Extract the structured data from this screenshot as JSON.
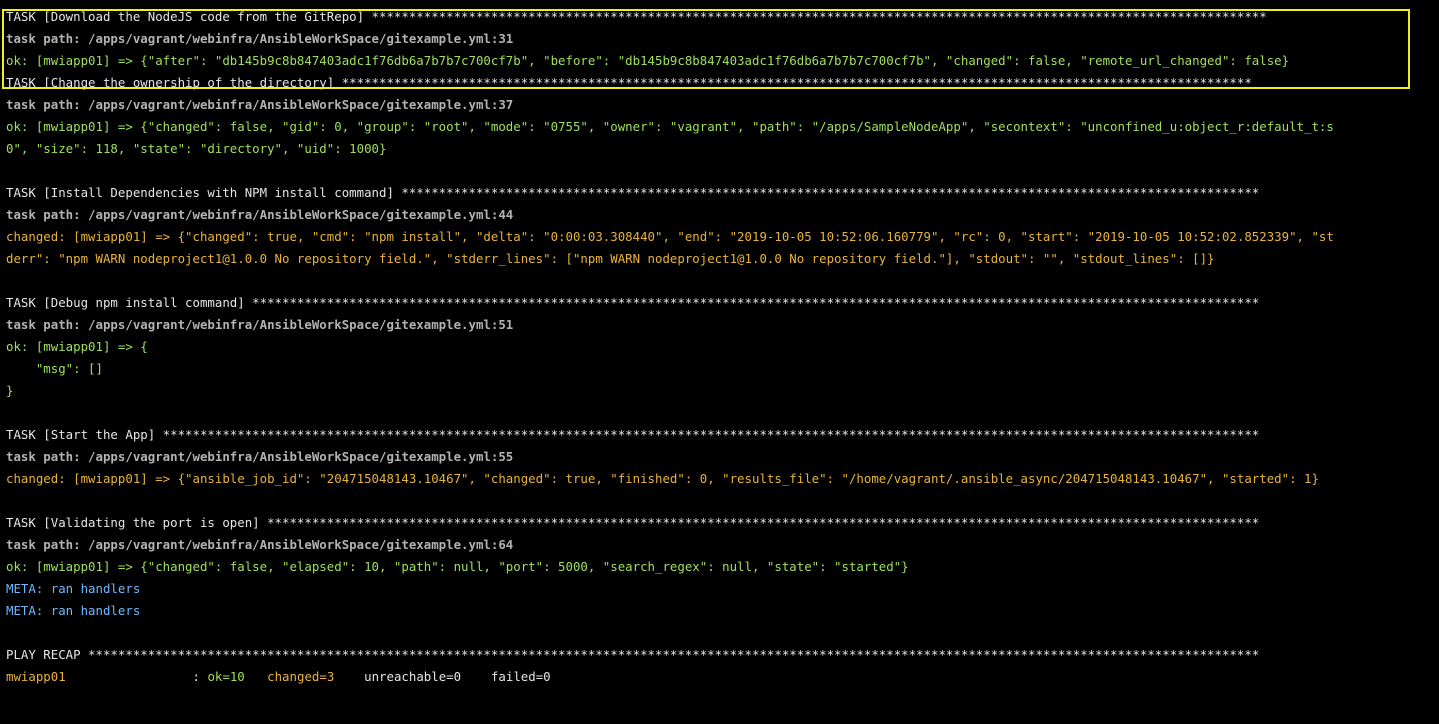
{
  "lines": [
    {
      "text": "TASK [Download the NodeJS code from the GitRepo] ************************************************************************************************************************",
      "kind": "task-header"
    },
    {
      "text": "task path: /apps/vagrant/webinfra/AnsibleWorkSpace/gitexample.yml:31",
      "kind": "task-path"
    },
    {
      "text": "ok: [mwiapp01] => {\"after\": \"db145b9c8b847403adc1f76db6a7b7b7c700cf7b\", \"before\": \"db145b9c8b847403adc1f76db6a7b7b7c700cf7b\", \"changed\": false, \"remote_url_changed\": false}",
      "kind": "ok"
    },
    {
      "text": "TASK [Change the ownership of the directory] **************************************************************************************************************************",
      "kind": "task-header"
    },
    {
      "text": "task path: /apps/vagrant/webinfra/AnsibleWorkSpace/gitexample.yml:37",
      "kind": "task-path"
    },
    {
      "text": "ok: [mwiapp01] => {\"changed\": false, \"gid\": 0, \"group\": \"root\", \"mode\": \"0755\", \"owner\": \"vagrant\", \"path\": \"/apps/SampleNodeApp\", \"secontext\": \"unconfined_u:object_r:default_t:s",
      "kind": "ok"
    },
    {
      "text": "0\", \"size\": 118, \"state\": \"directory\", \"uid\": 1000}",
      "kind": "ok"
    },
    {
      "text": "",
      "kind": "blank"
    },
    {
      "text": "TASK [Install Dependencies with NPM install command] *******************************************************************************************************************",
      "kind": "task-header"
    },
    {
      "text": "task path: /apps/vagrant/webinfra/AnsibleWorkSpace/gitexample.yml:44",
      "kind": "task-path"
    },
    {
      "text": "changed: [mwiapp01] => {\"changed\": true, \"cmd\": \"npm install\", \"delta\": \"0:00:03.308440\", \"end\": \"2019-10-05 10:52:06.160779\", \"rc\": 0, \"start\": \"2019-10-05 10:52:02.852339\", \"st",
      "kind": "changed"
    },
    {
      "text": "derr\": \"npm WARN nodeproject1@1.0.0 No repository field.\", \"stderr_lines\": [\"npm WARN nodeproject1@1.0.0 No repository field.\"], \"stdout\": \"\", \"stdout_lines\": []}",
      "kind": "changed"
    },
    {
      "text": "",
      "kind": "blank"
    },
    {
      "text": "TASK [Debug npm install command] ***************************************************************************************************************************************",
      "kind": "task-header"
    },
    {
      "text": "task path: /apps/vagrant/webinfra/AnsibleWorkSpace/gitexample.yml:51",
      "kind": "task-path"
    },
    {
      "text": "ok: [mwiapp01] => {",
      "kind": "ok"
    },
    {
      "text": "    \"msg\": []",
      "kind": "ok"
    },
    {
      "text": "}",
      "kind": "ok"
    },
    {
      "text": "",
      "kind": "blank"
    },
    {
      "text": "TASK [Start the App] ***************************************************************************************************************************************************",
      "kind": "task-header"
    },
    {
      "text": "task path: /apps/vagrant/webinfra/AnsibleWorkSpace/gitexample.yml:55",
      "kind": "task-path"
    },
    {
      "text": "changed: [mwiapp01] => {\"ansible_job_id\": \"204715048143.10467\", \"changed\": true, \"finished\": 0, \"results_file\": \"/home/vagrant/.ansible_async/204715048143.10467\", \"started\": 1}",
      "kind": "changed"
    },
    {
      "text": "",
      "kind": "blank"
    },
    {
      "text": "TASK [Validating the port is open] *************************************************************************************************************************************",
      "kind": "task-header"
    },
    {
      "text": "task path: /apps/vagrant/webinfra/AnsibleWorkSpace/gitexample.yml:64",
      "kind": "task-path"
    },
    {
      "text": "ok: [mwiapp01] => {\"changed\": false, \"elapsed\": 10, \"path\": null, \"port\": 5000, \"search_regex\": null, \"state\": \"started\"}",
      "kind": "ok"
    },
    {
      "text": "META: ran handlers",
      "kind": "meta"
    },
    {
      "text": "META: ran handlers",
      "kind": "meta"
    },
    {
      "text": "",
      "kind": "blank"
    },
    {
      "text": "PLAY RECAP *************************************************************************************************************************************************************",
      "kind": "task-header"
    }
  ],
  "recap": {
    "host": "mwiapp01",
    "separator": "                 : ",
    "ok": "ok=10",
    "gap1": "   ",
    "changed": "changed=3",
    "gap2": "    ",
    "unreachable": "unreachable=0",
    "gap3": "    ",
    "failed": "failed=0"
  },
  "highlight": {
    "color": "#f3ee1a"
  },
  "colors": {
    "background": "#000000",
    "ok": "#9fe05f",
    "changed": "#e8b33c",
    "meta": "#6fb8ff",
    "task_path": "#b3b3b3",
    "task_header": "#e6e6e6"
  }
}
